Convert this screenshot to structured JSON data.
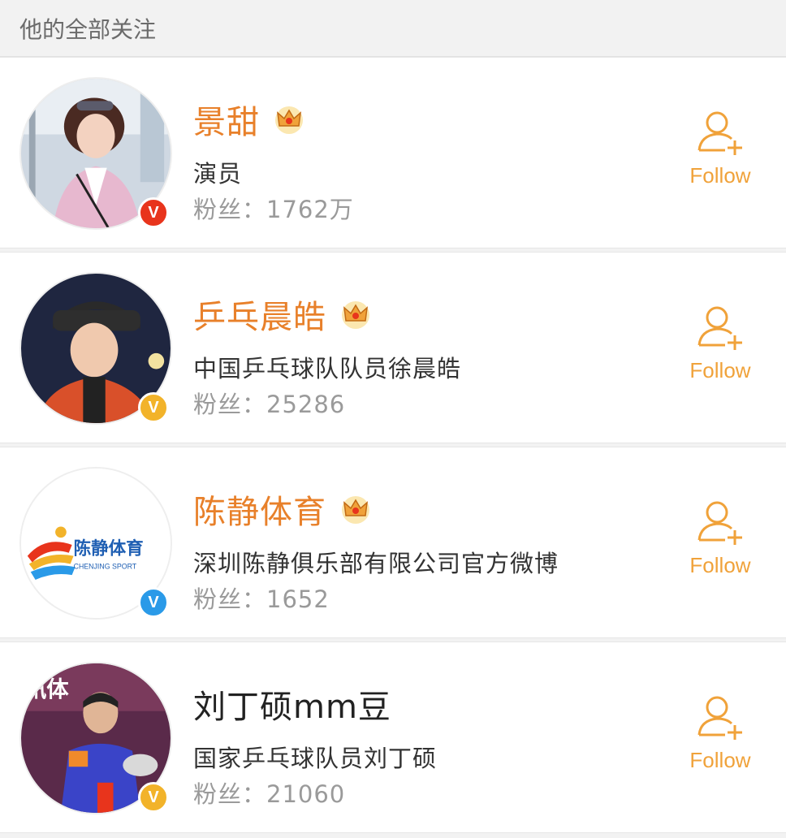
{
  "header": {
    "title": "他的全部关注"
  },
  "colors": {
    "name_orange": "#e8802a",
    "name_plain": "#222222",
    "follow_orange": "#f0a23a",
    "badge_red": "#e8341c",
    "badge_gold": "#f2b32a",
    "badge_blue": "#2a9ae8"
  },
  "follow_label": "Follow",
  "users": [
    {
      "name": "景甜",
      "description": "演员",
      "fans": "粉丝：1762万",
      "vip_crown": true,
      "verified": "red",
      "highlight_name": true,
      "avatar_icon": "person-photo"
    },
    {
      "name": "乒乓晨皓",
      "description": "中国乒乓球队队员徐晨皓",
      "fans": "粉丝：25286",
      "vip_crown": true,
      "verified": "gold",
      "highlight_name": true,
      "avatar_icon": "person-photo"
    },
    {
      "name": "陈静体育",
      "description": "深圳陈静俱乐部有限公司官方微博",
      "fans": "粉丝：1652",
      "vip_crown": true,
      "verified": "blue",
      "highlight_name": true,
      "avatar_icon": "brand-logo",
      "logo_text": "陈静体育",
      "logo_sub": "CHENJING SPORT"
    },
    {
      "name": "刘丁硕mm豆",
      "description": "国家乒乓球队员刘丁硕",
      "fans": "粉丝：21060",
      "vip_crown": false,
      "verified": "gold",
      "highlight_name": false,
      "avatar_icon": "person-photo",
      "avatar_text": "讯体"
    }
  ]
}
